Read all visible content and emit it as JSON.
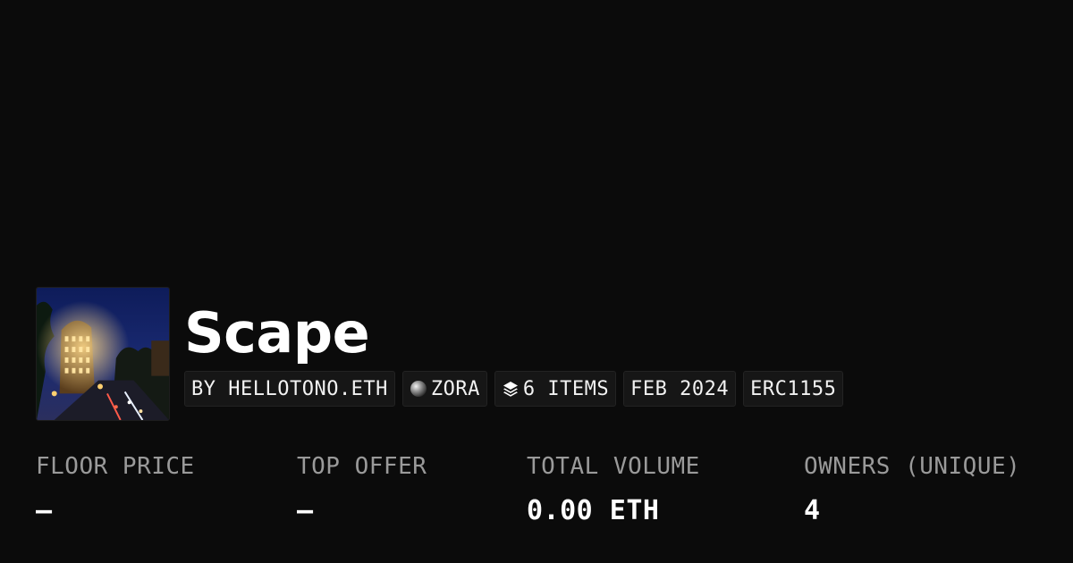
{
  "collection": {
    "name": "Scape",
    "thumbnail_icon": "night-city-street-photo"
  },
  "tags": {
    "creator": "BY HELLOTONO.ETH",
    "network": "ZORA",
    "network_icon": "zora-orb-icon",
    "items": "6 ITEMS",
    "items_icon": "layers-icon",
    "date": "FEB 2024",
    "standard": "ERC1155"
  },
  "stats": {
    "floor_price": {
      "label": "FLOOR PRICE",
      "value": "–"
    },
    "top_offer": {
      "label": "TOP OFFER",
      "value": "–"
    },
    "total_volume": {
      "label": "TOTAL VOLUME",
      "value": "0.00 ETH"
    },
    "owners": {
      "label": "OWNERS (UNIQUE)",
      "value": "4"
    }
  },
  "colors": {
    "background": "#0b0b0b",
    "text": "#ffffff",
    "muted": "#9a9a9a",
    "tag_bg": "#161616"
  }
}
